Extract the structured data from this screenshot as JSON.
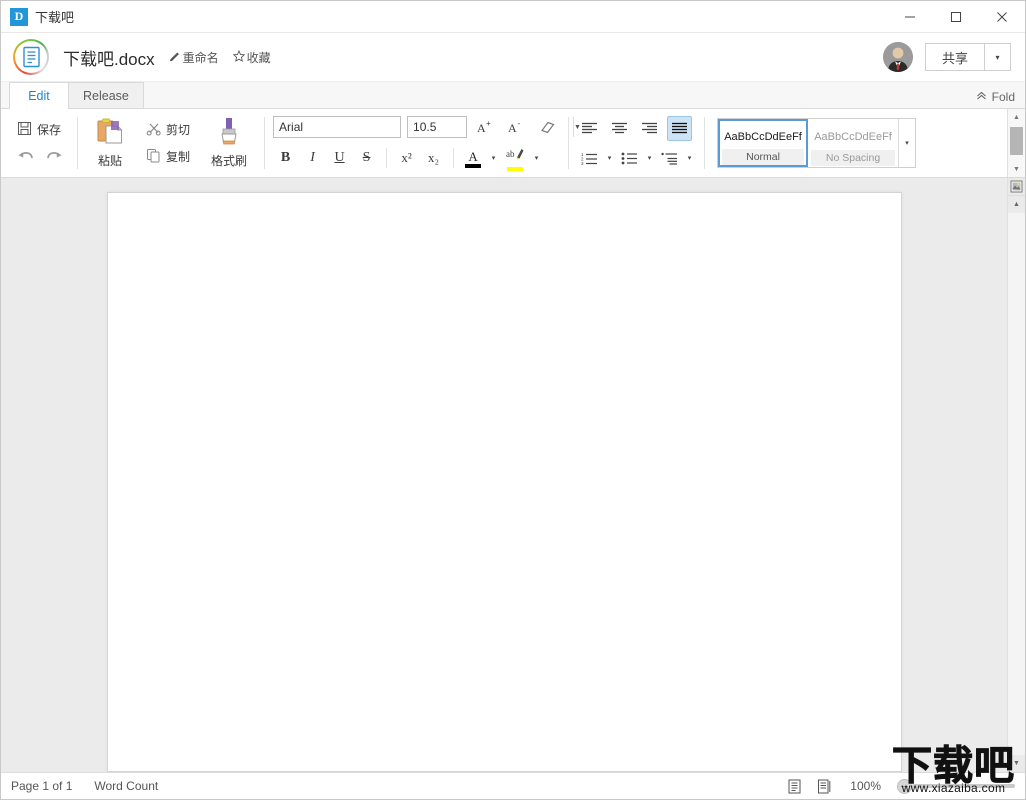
{
  "window": {
    "app_logo_letter": "D",
    "app_title": "下载吧",
    "minimize_label": "—",
    "maximize_label": "□",
    "close_label": "✕"
  },
  "doc_header": {
    "file_name": "下载吧.docx",
    "rename_label": "重命名",
    "favorite_label": "收藏",
    "share_label": "共享",
    "share_dropdown_label": "▾"
  },
  "tabs": [
    {
      "label": "Edit",
      "active": true
    },
    {
      "label": "Release",
      "active": false
    }
  ],
  "fold": {
    "label": "Fold",
    "icon": "chevron-double-up-icon"
  },
  "ribbon": {
    "save_label": "保存",
    "undo_label": "",
    "redo_label": "",
    "paste_label": "粘贴",
    "cut_label": "剪切",
    "copy_label": "复制",
    "format_painter_label": "格式刷",
    "font_name": "Arial",
    "font_size": "10.5",
    "grow_font_label": "A⁺",
    "shrink_font_label": "A⁻",
    "clear_format_label": "",
    "bold_label": "B",
    "italic_label": "I",
    "underline_label": "U",
    "strike_label": "S",
    "superscript_label": "x²",
    "subscript_label": "x₂",
    "font_color_label": "A",
    "font_color_value": "#000000",
    "highlight_label": "ab",
    "highlight_color_value": "#ffff00",
    "dropdown_arrow": "▾",
    "align_left_label": "",
    "align_center_label": "",
    "align_right_label": "",
    "align_justify_label": "",
    "active_alignment": "justify",
    "numbered_list_label": "",
    "bullet_list_label": "",
    "multilevel_list_label": "",
    "styles": [
      {
        "preview": "AaBbCcDdEeFf",
        "name": "Normal",
        "selected": true
      },
      {
        "preview": "AaBbCcDdEeFf",
        "name": "No Spacing",
        "selected": false
      }
    ],
    "styles_more_label": "▾"
  },
  "statusbar": {
    "page_info": "Page 1 of 1",
    "word_count": "Word Count",
    "zoom_level": "100%",
    "view_print_label": "",
    "view_web_label": ""
  },
  "watermark": {
    "logo_text": "下载吧",
    "url_text": "www.xiazaiba.com"
  },
  "colors": {
    "accent_blue": "#1a86d0",
    "tab_active_text": "#1a86d0",
    "ribbon_bg": "#ffffff",
    "canvas_bg": "#ebebeb",
    "page_bg": "#ffffff",
    "highlight_yellow": "#ffff00"
  }
}
